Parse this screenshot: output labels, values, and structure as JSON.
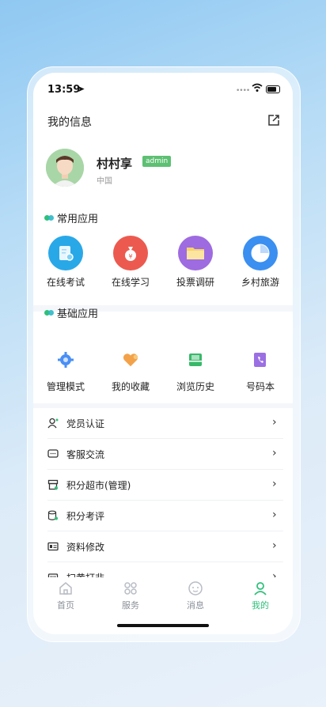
{
  "status": {
    "time": "13:59"
  },
  "header": {
    "title": "我的信息"
  },
  "profile": {
    "name": "村村享",
    "badge": "admin",
    "region": "中国"
  },
  "common": {
    "title": "常用应用",
    "items": [
      {
        "label": "在线考试",
        "icon": "exam-icon",
        "color": "#29a8e8"
      },
      {
        "label": "在线学习",
        "icon": "money-bag-icon",
        "color": "#ec5a4f"
      },
      {
        "label": "投票调研",
        "icon": "folder-icon",
        "color": "#9e6be0"
      },
      {
        "label": "乡村旅游",
        "icon": "pie-chart-icon",
        "color": "#3a8ff0"
      }
    ]
  },
  "basic": {
    "title": "基础应用",
    "items": [
      {
        "label": "管理模式",
        "icon": "gear-icon",
        "color": "#4a8ff5"
      },
      {
        "label": "我的收藏",
        "icon": "heart-icon",
        "color": "#f3a24a"
      },
      {
        "label": "浏览历史",
        "icon": "inbox-icon",
        "color": "#39b86a"
      },
      {
        "label": "号码本",
        "icon": "phone-book-icon",
        "color": "#9b6fe3"
      }
    ]
  },
  "menu": [
    {
      "label": "党员认证",
      "icon": "user-icon"
    },
    {
      "label": "客服交流",
      "icon": "chat-icon"
    },
    {
      "label": "积分超市(管理)",
      "icon": "store-icon"
    },
    {
      "label": "积分考评",
      "icon": "coins-icon"
    },
    {
      "label": "资料修改",
      "icon": "id-card-icon"
    },
    {
      "label": "扫黄打非",
      "icon": "shield-icon"
    }
  ],
  "tabs": [
    {
      "label": "首页",
      "icon": "home-icon"
    },
    {
      "label": "服务",
      "icon": "grid-icon"
    },
    {
      "label": "消息",
      "icon": "message-icon"
    },
    {
      "label": "我的",
      "icon": "person-icon"
    }
  ],
  "colors": {
    "accent": "#2ec07a",
    "badge": "#5dc073"
  }
}
